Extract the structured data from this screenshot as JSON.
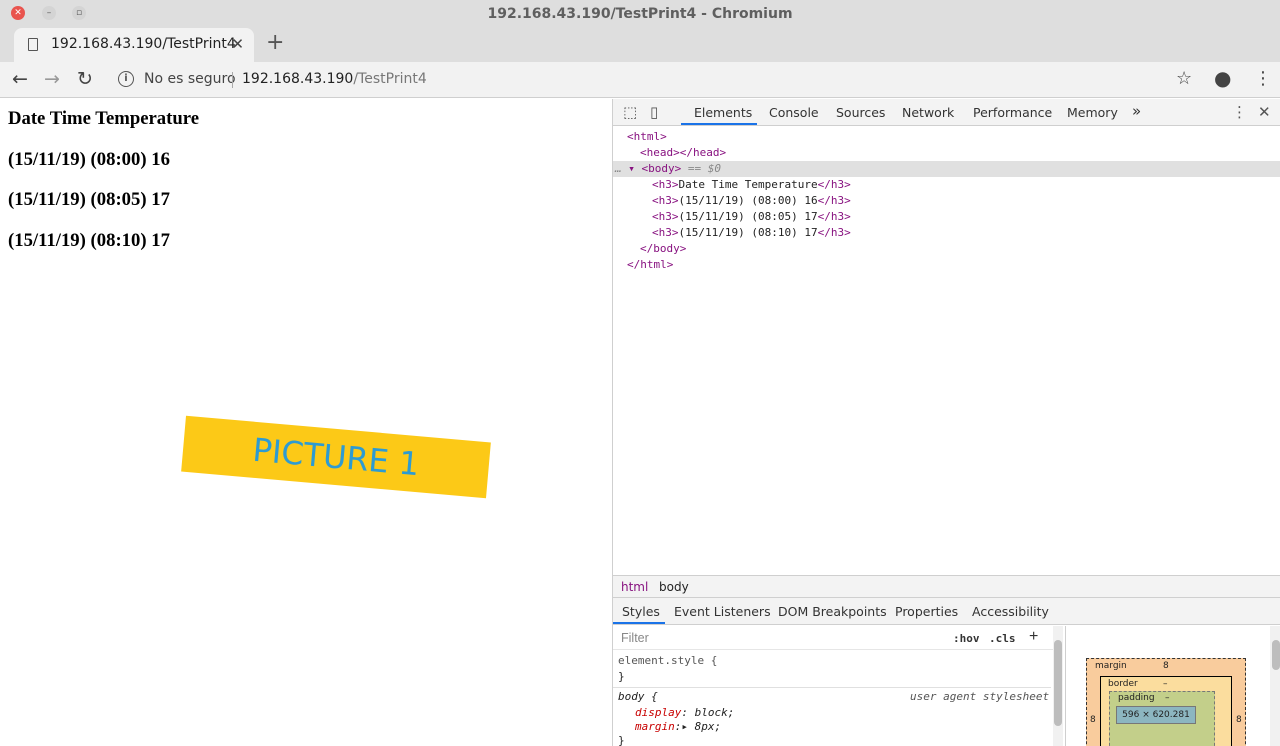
{
  "window": {
    "title": "192.168.43.190/TestPrint4 - Chromium"
  },
  "tabs": [
    {
      "label": "192.168.43.190/TestPrint4"
    }
  ],
  "toolbar": {
    "security_label": "No es seguro",
    "url_host": "192.168.43.190",
    "url_path": "/TestPrint4"
  },
  "page": {
    "headings": [
      "Date Time Temperature",
      "(15/11/19) (08:00) 16",
      "(15/11/19) (08:05) 17",
      "(15/11/19) (08:10) 17"
    ],
    "picture_label": "PICTURE 1"
  },
  "devtools": {
    "tabs": [
      "Elements",
      "Console",
      "Sources",
      "Network",
      "Performance",
      "Memory"
    ],
    "more": "»",
    "dom": {
      "html_open": "<html>",
      "head": "<head></head>",
      "body_open": "<body>",
      "body_marker": " == $0",
      "h3_lines": [
        "Date Time Temperature",
        "(15/11/19) (08:00) 16",
        "(15/11/19) (08:05) 17",
        "(15/11/19) (08:10) 17"
      ],
      "body_close": "</body>",
      "html_close": "</html>"
    },
    "breadcrumbs": [
      "html",
      "body"
    ],
    "subtabs": [
      "Styles",
      "Event Listeners",
      "DOM Breakpoints",
      "Properties",
      "Accessibility"
    ],
    "styles": {
      "filter_placeholder": "Filter",
      "hov": ":hov",
      "cls": ".cls",
      "element_style": "element.style {",
      "close_brace": "}",
      "body_selector": "body {",
      "user_agent": "user agent stylesheet",
      "rules": [
        {
          "prop": "display",
          "value": "block;"
        },
        {
          "prop": "margin",
          "value": "8px;"
        }
      ]
    },
    "box_model": {
      "margin_label": "margin",
      "margin_value": "8",
      "border_label": "border",
      "border_value": "–",
      "padding_label": "padding",
      "padding_value": "–",
      "content_size": "596 × 620.281",
      "side_left": "8",
      "side_right": "8"
    }
  }
}
